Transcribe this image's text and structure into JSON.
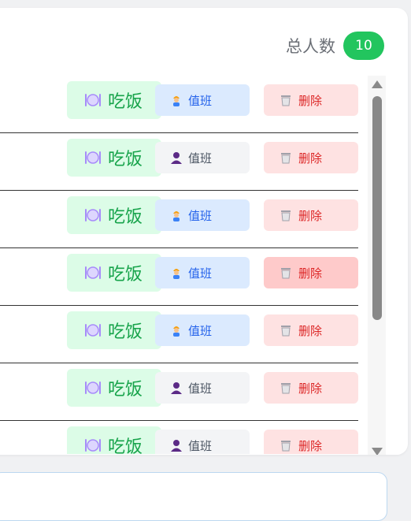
{
  "header": {
    "total_label": "总人数",
    "total_count": "10"
  },
  "colors": {
    "count_pill": "#22c55e",
    "eat_bg": "#dcfce7",
    "eat_text": "#16a34a",
    "duty_on_bg": "#dbeafe",
    "duty_on_text": "#2563eb",
    "duty_off_bg": "#f3f4f6",
    "duty_off_text": "#4b5563",
    "delete_bg": "#fee2e2",
    "delete_text": "#dc2626"
  },
  "rows": [
    {
      "eat_label": "吃饭",
      "duty_label": "值班",
      "duty_icon": "construction-worker-icon",
      "delete_label": "删除"
    },
    {
      "eat_label": "吃饭",
      "duty_label": "值班",
      "duty_icon": "person-silhouette-icon",
      "delete_label": "删除"
    },
    {
      "eat_label": "吃饭",
      "duty_label": "值班",
      "duty_icon": "construction-worker-icon",
      "delete_label": "删除"
    },
    {
      "eat_label": "吃饭",
      "duty_label": "值班",
      "duty_icon": "construction-worker-icon",
      "delete_label": "删除"
    },
    {
      "eat_label": "吃饭",
      "duty_label": "值班",
      "duty_icon": "construction-worker-icon",
      "delete_label": "删除"
    },
    {
      "eat_label": "吃饭",
      "duty_label": "值班",
      "duty_icon": "person-silhouette-icon",
      "delete_label": "删除"
    },
    {
      "eat_label": "吃饭",
      "duty_label": "值班",
      "duty_icon": "person-silhouette-icon",
      "delete_label": "删除"
    }
  ]
}
